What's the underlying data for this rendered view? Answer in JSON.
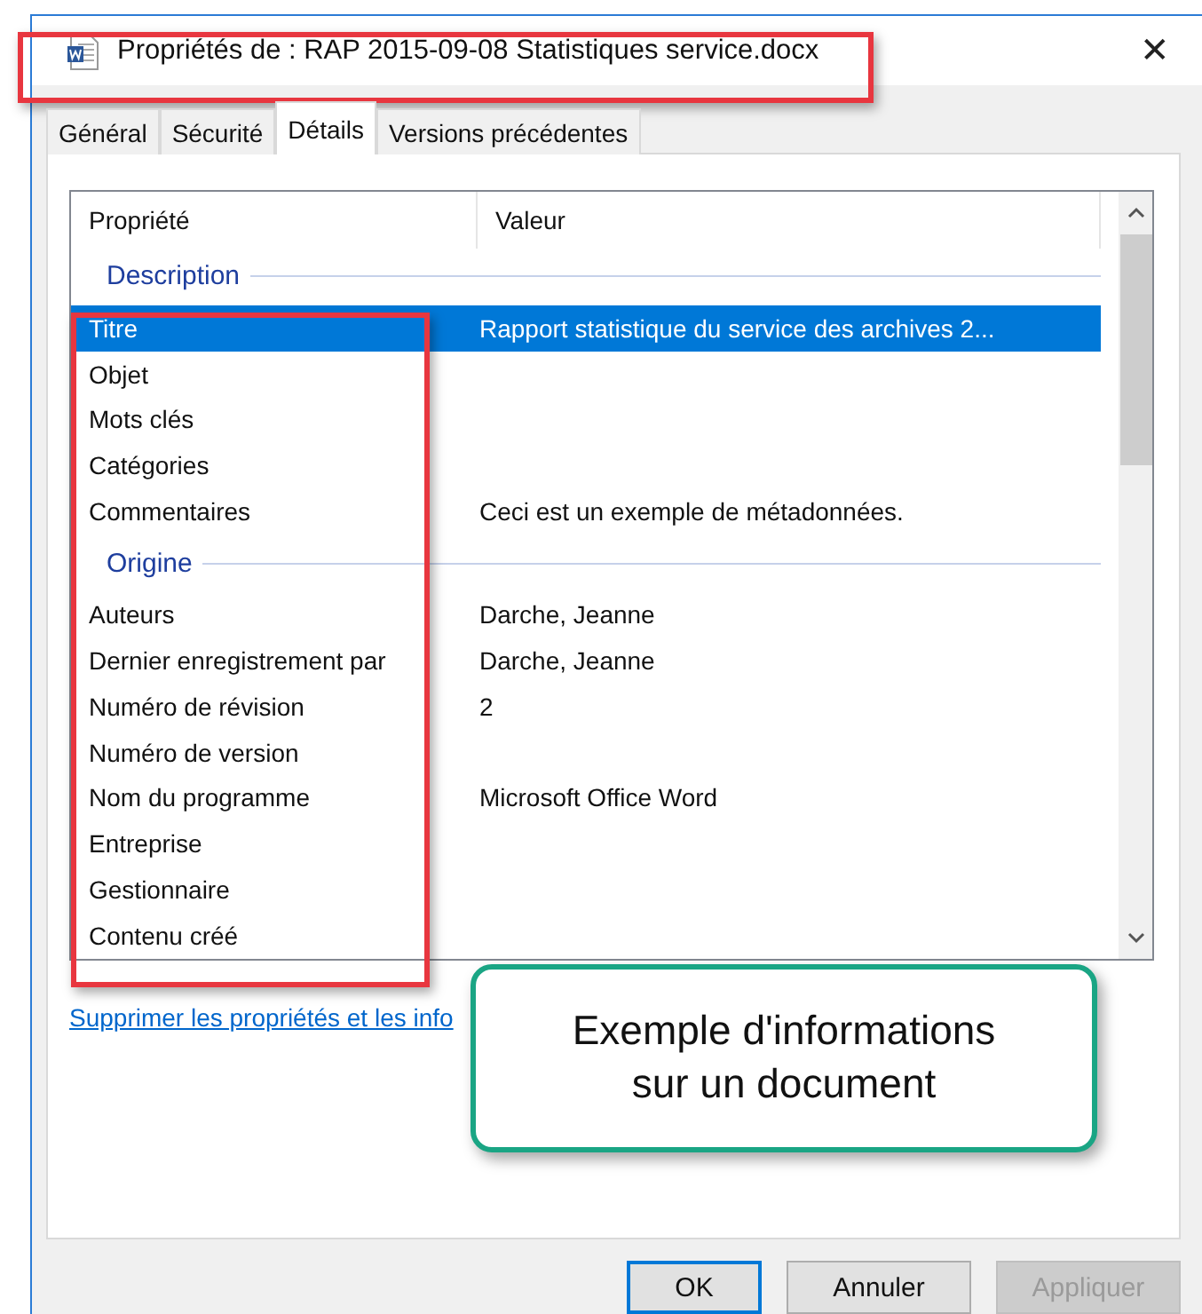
{
  "window": {
    "title": "Propriétés de : RAP 2015-09-08 Statistiques service.docx",
    "close": "✕"
  },
  "tabs": [
    {
      "label": "Général",
      "selected": false
    },
    {
      "label": "Sécurité",
      "selected": false
    },
    {
      "label": "Détails",
      "selected": true
    },
    {
      "label": "Versions précédentes",
      "selected": false
    }
  ],
  "table": {
    "columns": [
      "Propriété",
      "Valeur"
    ],
    "groups": [
      {
        "label": "Description",
        "rows": [
          {
            "name": "Titre",
            "value": "Rapport statistique du service des archives 2...",
            "selected": true
          },
          {
            "name": "Objet",
            "selected": false
          },
          {
            "name": "Mots clés",
            "selected": false
          },
          {
            "name": "Catégories",
            "selected": false
          },
          {
            "name": "Commentaires",
            "value": "Ceci est un exemple de métadonnées.",
            "selected": false
          }
        ]
      },
      {
        "label": "Origine",
        "rows": [
          {
            "name": "Auteurs",
            "value": "Darche, Jeanne",
            "selected": false
          },
          {
            "name": "Dernier enregistrement par",
            "value": "Darche, Jeanne",
            "selected": false
          },
          {
            "name": "Numéro de révision",
            "value": "2",
            "selected": false
          },
          {
            "name": "Numéro de version",
            "selected": false
          },
          {
            "name": "Nom du programme",
            "value": "Microsoft Office Word",
            "selected": false
          },
          {
            "name": "Entreprise",
            "selected": false
          },
          {
            "name": "Gestionnaire",
            "selected": false
          },
          {
            "name": "Contenu créé",
            "selected": false
          }
        ]
      }
    ]
  },
  "link": "Supprimer les propriétés et les info",
  "buttons": [
    {
      "label": "OK",
      "default": true,
      "disabled": false
    },
    {
      "label": "Annuler",
      "default": false,
      "disabled": false
    },
    {
      "label": "Appliquer",
      "default": false,
      "disabled": true
    }
  ],
  "callout": {
    "text": "Exemple d'informations sur un document"
  }
}
